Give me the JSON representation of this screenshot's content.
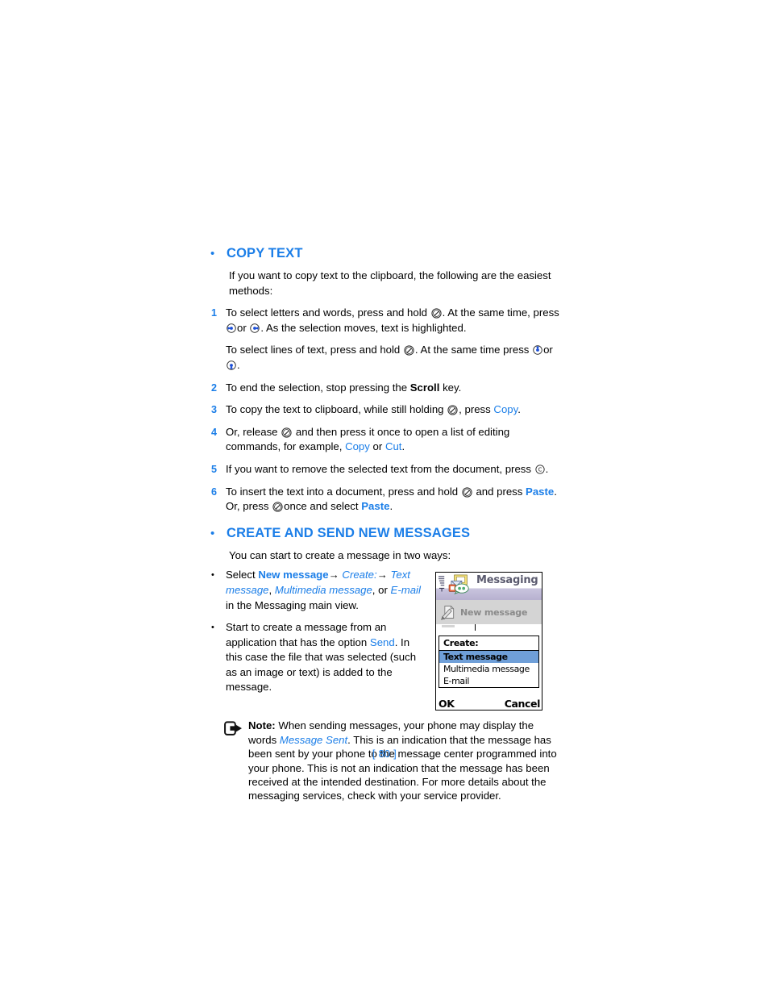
{
  "page": {
    "number_label": "[ 80 ]",
    "accent_color": "#1b7ee8",
    "text_color": "#000000",
    "background": "#ffffff"
  },
  "sections": [
    {
      "bullet": "•",
      "title": "COPY TEXT",
      "intro": "If you want to copy text to the clipboard, the following are the easiest methods:"
    },
    {
      "bullet": "•",
      "title": "CREATE AND SEND NEW MESSAGES",
      "intro": "You can start to create a message in two ways:"
    }
  ],
  "copy_text_steps": {
    "step1": {
      "num": "1",
      "part_a": "To select letters and words, press and hold",
      "part_b": ". At the same time, press",
      "part_c": "or",
      "part_d": ". As the selection moves, text is highlighted.",
      "sub_a": "To select lines of text, press and hold",
      "sub_b": ". At the same time press",
      "sub_c": "or",
      "sub_d": "."
    },
    "step2": {
      "num": "2",
      "part_a": "To end the selection, stop pressing the",
      "bold_word": "Scroll",
      "part_b": "key."
    },
    "step3": {
      "num": "3",
      "part_a": "To copy the text to clipboard, while still holding",
      "part_b": ", press",
      "link": "Copy",
      "part_c": "."
    },
    "step4": {
      "num": "4",
      "part_a": "Or, release",
      "part_b": "and then press it once to open a list of editing commands, for example,",
      "link1": "Copy",
      "middle": "or",
      "link2": "Cut",
      "part_c": "."
    },
    "step5": {
      "num": "5",
      "part_a": "If you want to remove the selected text from the document, press",
      "part_b": "."
    },
    "step6": {
      "num": "6",
      "part_a": "To insert the text into a document, press and hold",
      "part_b": "and press",
      "link1": "Paste",
      "part_c": ". Or, press",
      "part_d": "once and select",
      "link2": "Paste",
      "part_e": "."
    }
  },
  "create_messages": {
    "bullet1": {
      "bullet": "•",
      "part_a": "Select",
      "bold_link": "New message",
      "arrow1": "→",
      "italic1": "Create:",
      "arrow2": "→",
      "italic2": "Text message",
      "comma": ",",
      "italic3": "Multimedia message",
      "or": ", or",
      "italic4": "E-mail",
      "part_b": "in the Messaging main view."
    },
    "bullet2": {
      "bullet": "•",
      "part_a": "Start to create a message from an application that has the option",
      "link": "Send",
      "part_b": ". In this case the file that was selected (such as an image or text) is added to the message."
    }
  },
  "phone_mockup": {
    "app_title": "Messaging",
    "list_row_label": "New message",
    "popup": {
      "header": "Create:",
      "items": [
        {
          "label": "Text message",
          "selected": true
        },
        {
          "label": "Multimedia message",
          "selected": false
        },
        {
          "label": "E-mail",
          "selected": false
        }
      ]
    },
    "softkey_left": "OK",
    "softkey_right": "Cancel",
    "selection_color": "#6f9fd8"
  },
  "note": {
    "label": "Note:",
    "part_a": "When sending messages, your phone may display the words",
    "italic": "Message Sent",
    "part_b": ". This is an indication that the message has been sent by your phone to the message center programmed into your phone. This is not an indication that the message has been received at the intended destination. For more details about the messaging services, check with your service provider."
  }
}
